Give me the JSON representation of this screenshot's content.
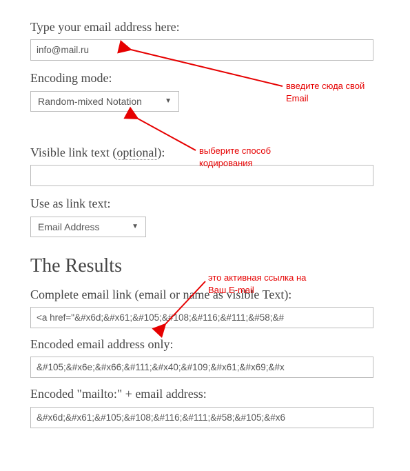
{
  "form": {
    "email_label": "Type your email address here:",
    "email_value": "info@mail.ru",
    "encoding_label": "Encoding mode:",
    "encoding_value": "Random-mixed Notation",
    "visible_label_prefix": "Visible link text (",
    "visible_label_optional": "optional",
    "visible_label_suffix": "):",
    "visible_value": "",
    "use_as_label": "Use as link text:",
    "use_as_value": "Email Address"
  },
  "results": {
    "heading": "The Results",
    "complete_label": "Complete email link (email or name as visible Text):",
    "complete_value": "<a href=\"&#x6d;&#x61;&#105;&#108;&#116;&#111;&#58;&#",
    "encoded_addr_label": "Encoded email address only:",
    "encoded_addr_value": "&#105;&#x6e;&#x66;&#111;&#x40;&#109;&#x61;&#x69;&#x",
    "encoded_mailto_label": "Encoded \"mailto:\" + email address:",
    "encoded_mailto_value": "&#x6d;&#x61;&#105;&#108;&#116;&#111;&#58;&#105;&#x6"
  },
  "annotations": {
    "a1": "введите сюда свой\nEmail",
    "a2": "выберите способ\nкодирования",
    "a3": "это активная ссылка на\nВаш E-mail"
  }
}
